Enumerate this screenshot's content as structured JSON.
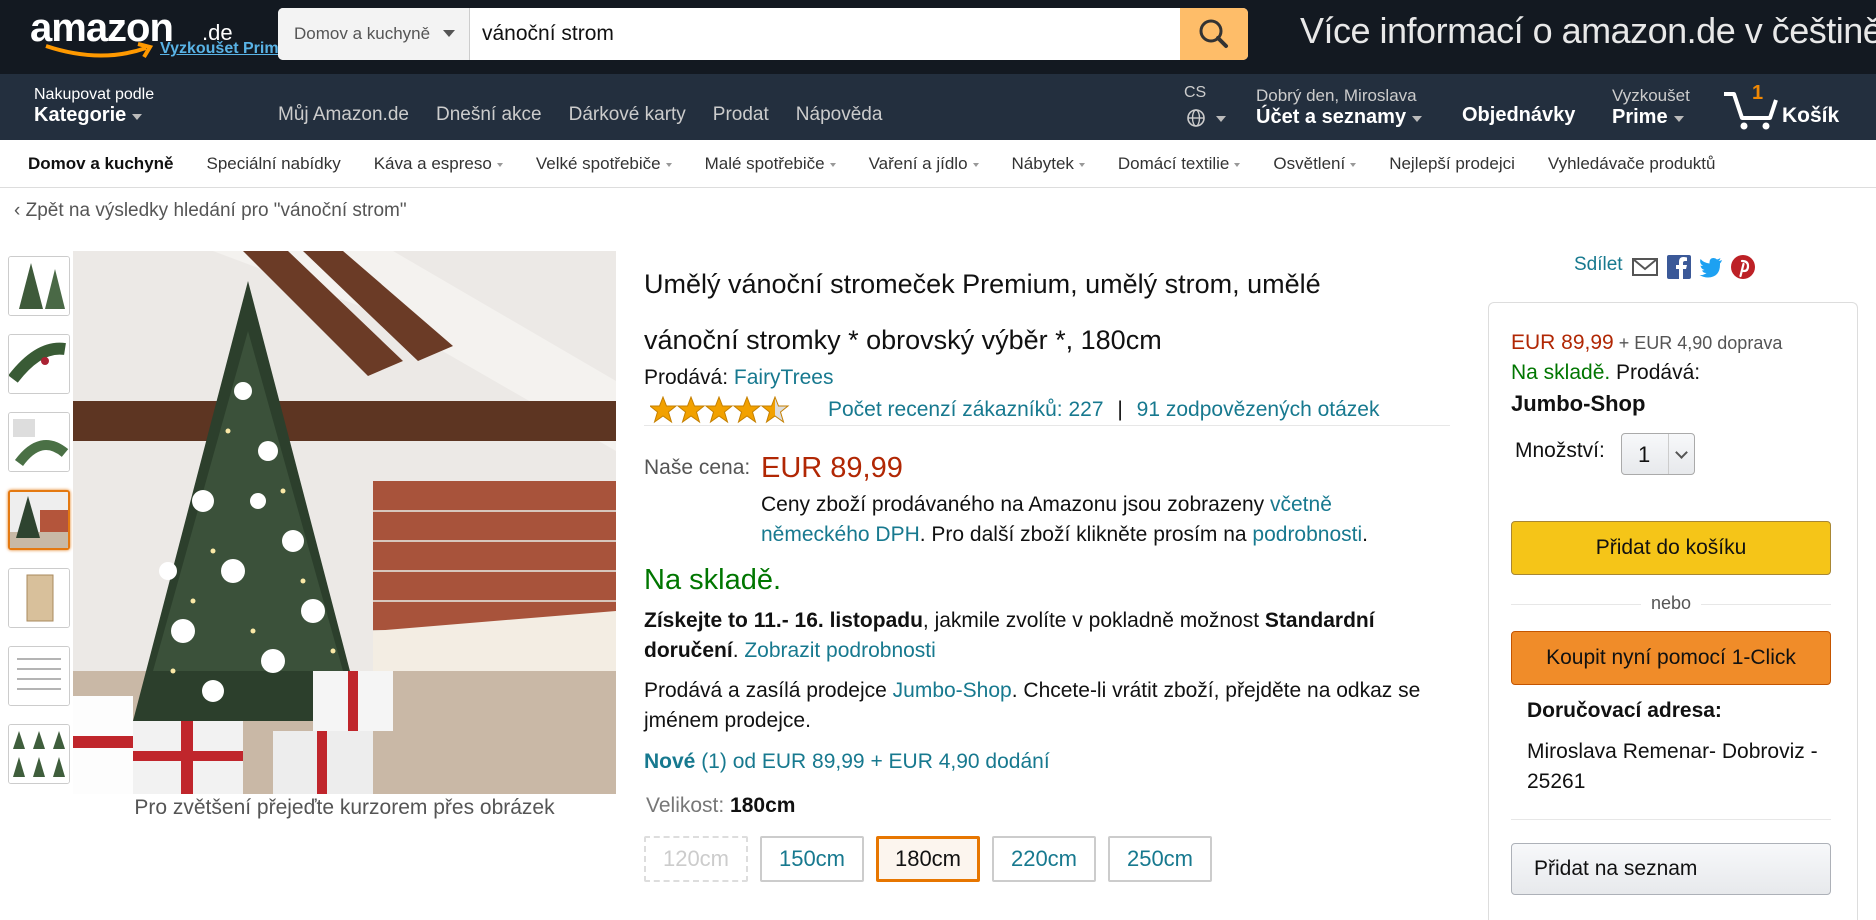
{
  "header": {
    "logo_word": "amazon",
    "logo_tld": ".de",
    "try_prime": "Vyzkoušet Prime",
    "search": {
      "department": "Domov a kuchyně",
      "query": "vánoční strom"
    },
    "promo": "Více informací o amazon.de v češtině"
  },
  "nav": {
    "categories_small": "Nakupovat podle",
    "categories_big": "Kategorie",
    "links": [
      "Můj Amazon.de",
      "Dnešní akce",
      "Dárkové karty",
      "Prodat",
      "Nápověda"
    ],
    "lang": "CS",
    "greeting": "Dobrý den, Miroslava",
    "account": "Účet a seznamy",
    "orders": "Objednávky",
    "prime_small": "Vyzkoušet",
    "prime_big": "Prime",
    "cart_count": "1",
    "cart_label": "Košík"
  },
  "subnav": {
    "items": [
      {
        "label": "Domov a kuchyně"
      },
      {
        "label": "Speciální nabídky"
      },
      {
        "label": "Káva a espreso"
      },
      {
        "label": "Velké spotřebiče"
      },
      {
        "label": "Malé spotřebiče"
      },
      {
        "label": "Vaření a jídlo"
      },
      {
        "label": "Nábytek"
      },
      {
        "label": "Domácí textilie"
      },
      {
        "label": "Osvětlení"
      },
      {
        "label": "Nejlepší prodejci"
      },
      {
        "label": "Vyhledávače produktů"
      }
    ]
  },
  "breadcrumb": {
    "back": "‹ Zpět na výsledky hledání pro \"vánoční strom\""
  },
  "gallery": {
    "zoom_hint": "Pro zvětšení přejeďte kurzorem přes obrázek",
    "selected_index": 3,
    "thumb_count": 7
  },
  "product": {
    "title_line1": "Umělý vánoční stromeček Premium, umělý strom, umělé",
    "title_line2": "vánoční stromky * obrovský výběr *, 180cm",
    "seller_label": "Prodává: ",
    "seller": "FairyTrees",
    "rating": 4.5,
    "reviews": "Počet recenzí zákazníků: 227",
    "sep": "|",
    "answered": "91 zodpovězených otázek",
    "price_label": "Naše cena:",
    "price": "EUR 89,99",
    "price_note_1": "Ceny zboží prodávaného na Amazonu jsou zobrazeny ",
    "price_note_link1": "včetně německého DPH",
    "price_note_2": ". Pro další zboží klikněte prosím na ",
    "price_note_link2": "podrobnosti",
    "price_note_3": ".",
    "in_stock": "Na skladě.",
    "delivery_b1": "Získejte to 11.- 16. listopadu",
    "delivery_t1": ", jakmile zvolíte v pokladně možnost ",
    "delivery_b2": "Standardní doručení",
    "delivery_t2": ". ",
    "delivery_link": "Zobrazit podrobnosti",
    "ships_1": "Prodává a zasílá prodejce ",
    "ships_link": "Jumbo-Shop",
    "ships_2": ". Chcete-li vrátit zboží, přejděte na odkaz se jménem prodejce.",
    "new_bold": "Nové",
    "new_rest": " (1) od EUR 89,99 + EUR 4,90 dodání",
    "size_label": "Velikost: ",
    "size_value": "180cm",
    "sizes": [
      {
        "label": "120cm"
      },
      {
        "label": "150cm"
      },
      {
        "label": "180cm"
      },
      {
        "label": "220cm"
      },
      {
        "label": "250cm"
      }
    ]
  },
  "share": {
    "label": "Sdílet"
  },
  "buybox": {
    "price": "EUR 89,99",
    "shipping": " + EUR 4,90 doprava",
    "stock": "Na skladě.",
    "sold_by": " Prodává:",
    "seller": "Jumbo-Shop",
    "qty_label": "Množství:",
    "qty": "1",
    "add_to_cart": "Přidat do košíku",
    "or": "nebo",
    "buy_now": "Koupit nyní pomocí 1-Click",
    "address_label": "Doručovací adresa:",
    "address": "Miroslava Remenar- Dobroviz - 25261",
    "add_to_list": "Přidat na seznam"
  },
  "colors": {
    "accent": "#febd69",
    "price": "#b12704",
    "stock": "#007600",
    "link": "#17798f",
    "topbar": "#131921",
    "nav": "#232f3e"
  }
}
